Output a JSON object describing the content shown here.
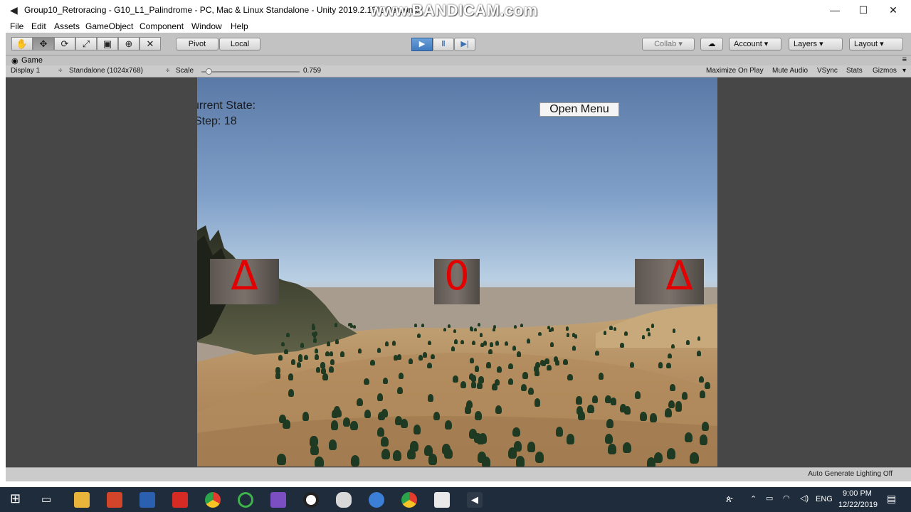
{
  "window": {
    "title": "Group10_Retroracing - G10_L1_Palindrome - PC, Mac & Linux Standalone - Unity 2019.2.13f1 Personal",
    "watermark": "www.BANDICAM.com",
    "controls": {
      "minimize": "—",
      "maximize": "☐",
      "close": "✕"
    }
  },
  "menu": [
    "File",
    "Edit",
    "Assets",
    "GameObject",
    "Component",
    "Window",
    "Help"
  ],
  "toolbar": {
    "tools": [
      "hand-tool",
      "move-tool",
      "rotate-tool",
      "scale-tool",
      "rect-tool",
      "transform-tool",
      "custom-tool"
    ],
    "pivot_label": "Pivot",
    "local_label": "Local",
    "collab_label": "Collab",
    "account_label": "Account",
    "layers_label": "Layers",
    "layout_label": "Layout"
  },
  "game_panel": {
    "tab_label": "Game",
    "display": "Display 1",
    "resolution": "Standalone (1024x768)",
    "scale_label": "Scale",
    "scale_value": "0.759",
    "scale_fraction": 0.759,
    "maximize_on_play": "Maximize On Play",
    "mute_audio": "Mute Audio",
    "vsync": "VSync",
    "stats": "Stats",
    "gizmos": "Gizmos"
  },
  "game": {
    "state_label": "urrent State:",
    "step_label": "Step: 18",
    "open_menu": "Open Menu",
    "cubes": [
      {
        "glyph": "Δ"
      },
      {
        "glyph": "0"
      },
      {
        "glyph": "Δ"
      }
    ]
  },
  "status": {
    "lighting": "Auto Generate Lighting Off"
  },
  "taskbar": {
    "language": "ENG",
    "time": "9:00 PM",
    "date": "12/22/2019"
  }
}
